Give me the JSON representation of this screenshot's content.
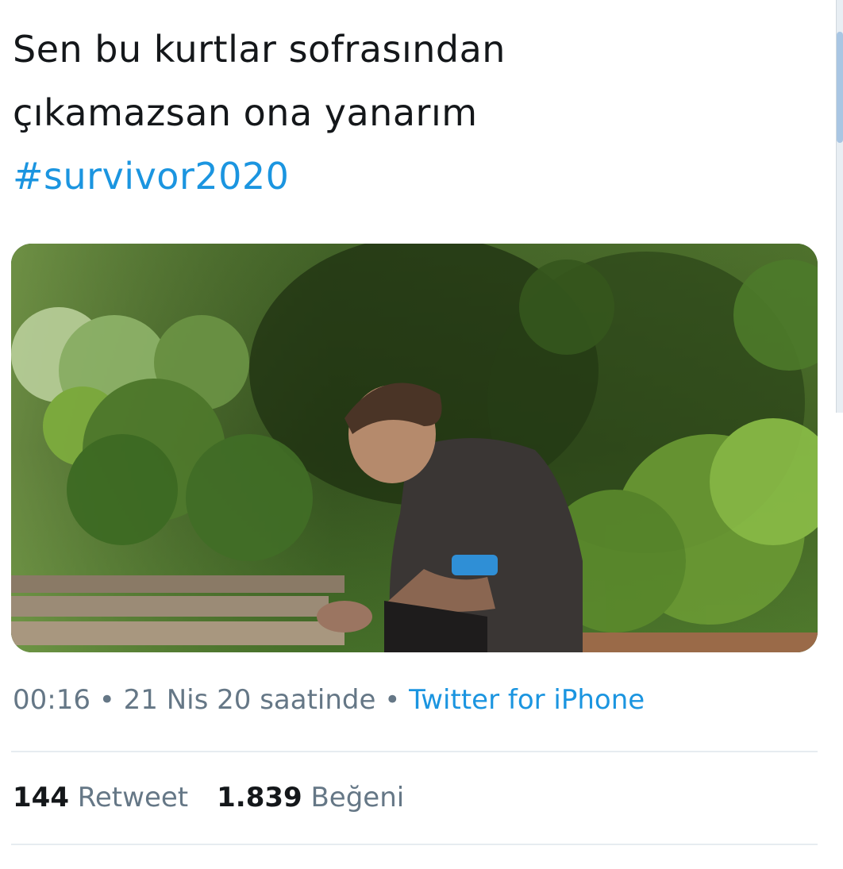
{
  "tweet": {
    "line1": "Sen bu kurtlar sofrasından",
    "line2": "çıkamazsan ona yanarım",
    "hashtag": "#survivor2020"
  },
  "media": {
    "description_icon": "photo-icon"
  },
  "meta": {
    "time": "00:16",
    "separator": " • ",
    "date": "21 Nis 20 saatinde",
    "source": "Twitter for iPhone"
  },
  "stats": {
    "retweet_count": "144",
    "retweet_label": "Retweet",
    "like_count": "1.839",
    "like_label": "Beğeni"
  },
  "colors": {
    "accent": "#1b95e0",
    "text": "#14171a",
    "muted": "#657786",
    "divider": "#e6ecf0"
  }
}
